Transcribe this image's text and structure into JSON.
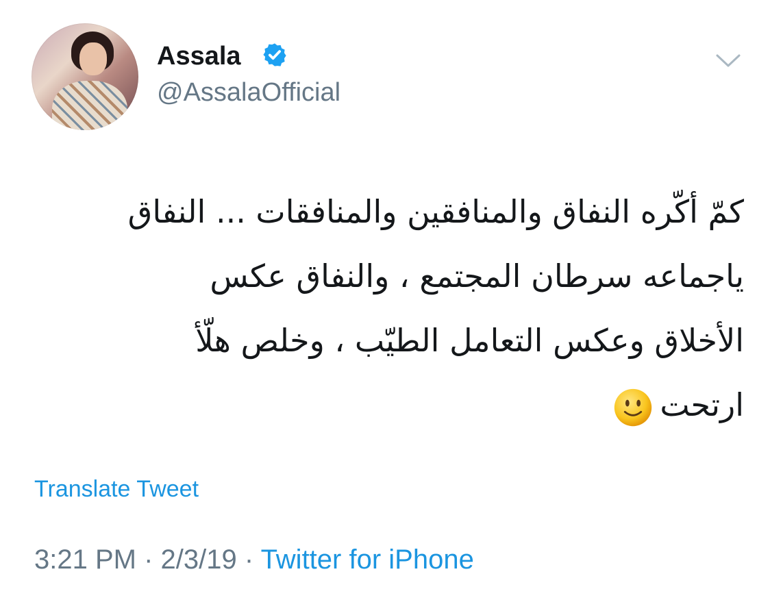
{
  "author": {
    "name": "Assala",
    "handle": "@AssalaOfficial",
    "avatar_icon": "profile-photo",
    "verified_icon": "verified-badge-icon",
    "verified_color": "#1da1f2"
  },
  "menu_icon": "chevron-down-icon",
  "tweet": {
    "lines": [
      "كمّ أكّره النفاق والمنافقين والمنافقات ... النفاق",
      "ياجماعه سرطان المجتمع ، والنفاق عكس",
      "الأخلاق وعكس التعامل الطيّب ، وخلص هلّأ",
      "ارتحت"
    ],
    "emoji_icon": "slightly-smiling-face-emoji"
  },
  "translate_label": "Translate Tweet",
  "meta": {
    "time": "3:21 PM",
    "sep1": " · ",
    "date": "2/3/19",
    "sep2": " · ",
    "source": "Twitter for iPhone"
  },
  "colors": {
    "text": "#14171a",
    "secondary": "#657786",
    "link": "#1b95e0"
  }
}
